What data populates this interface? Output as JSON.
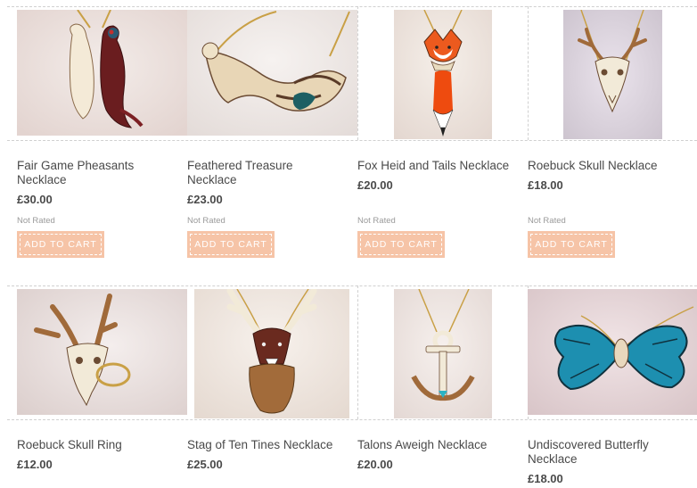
{
  "products": [
    {
      "name": "Fair Game Pheasants Necklace",
      "price": "£30.00",
      "rating": "Not Rated",
      "cta": "ADD TO CART",
      "image": "pheasants-necklace-photo"
    },
    {
      "name": "Feathered Treasure Necklace",
      "price": "£23.00",
      "rating": "Not Rated",
      "cta": "ADD TO CART",
      "image": "feathered-treasure-necklace-photo"
    },
    {
      "name": "Fox Heid and Tails Necklace",
      "price": "£20.00",
      "rating": "Not Rated",
      "cta": "ADD TO CART",
      "image": "fox-necklace-photo"
    },
    {
      "name": "Roebuck Skull Necklace",
      "price": "£18.00",
      "rating": "Not Rated",
      "cta": "ADD TO CART",
      "image": "roebuck-skull-necklace-photo"
    },
    {
      "name": "Roebuck Skull Ring",
      "price": "£12.00",
      "image": "roebuck-skull-ring-photo"
    },
    {
      "name": "Stag of Ten Tines Necklace",
      "price": "£25.00",
      "image": "stag-necklace-photo"
    },
    {
      "name": "Talons Aweigh Necklace",
      "price": "£20.00",
      "image": "anchor-necklace-photo"
    },
    {
      "name": "Undiscovered Butterfly Necklace",
      "price": "£18.00",
      "image": "butterfly-necklace-photo"
    }
  ],
  "colors": {
    "button": "#f6c4a7",
    "button_text": "#ffffff",
    "divider": "#d0d0d0",
    "text": "#4a4a4a"
  }
}
